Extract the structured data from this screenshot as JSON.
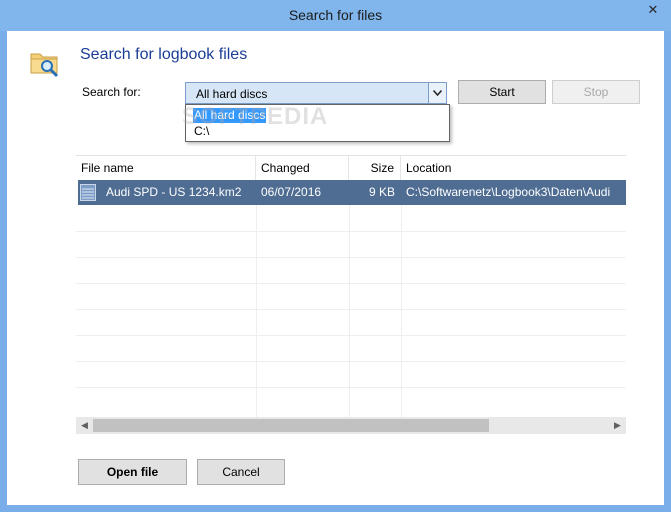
{
  "window": {
    "title": "Search for files"
  },
  "heading": "Search for logbook files",
  "search": {
    "label": "Search for:",
    "selected": "All hard discs",
    "options": [
      "All hard discs",
      "C:\\"
    ]
  },
  "buttons": {
    "start": "Start",
    "stop": "Stop",
    "open_file": "Open file",
    "cancel": "Cancel"
  },
  "watermark": "SOFTPEDIA",
  "table": {
    "columns": [
      "File name",
      "Changed",
      "Size",
      "Location"
    ],
    "rows": [
      {
        "file_name": "Audi SPD - US 1234.km2",
        "changed": "06/07/2016",
        "size": "9 KB",
        "location": "C:\\Softwarenetz\\Logbook3\\Daten\\Audi"
      }
    ]
  },
  "colors": {
    "accent": "#1a3e96",
    "selection": "#4f6c92",
    "titlebar": "#80b6ec"
  },
  "icons": {
    "window_close": "close-icon",
    "dialog": "folder-search-icon",
    "file": "km2-file-icon"
  }
}
